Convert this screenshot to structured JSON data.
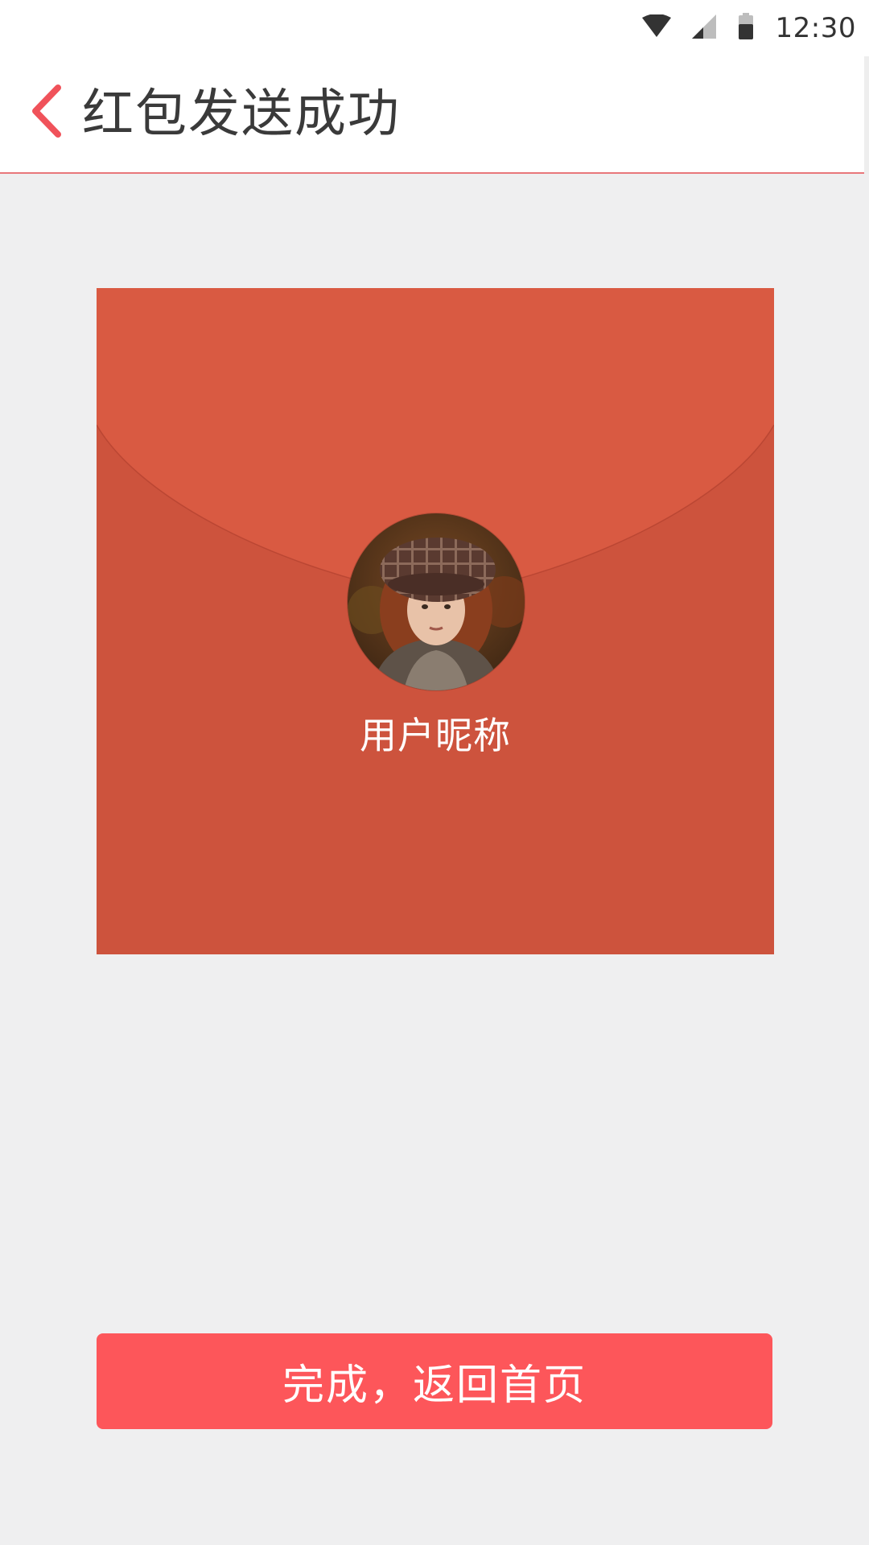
{
  "status_bar": {
    "time": "12:30",
    "icons": [
      "wifi-icon",
      "cell-signal-icon",
      "battery-icon"
    ]
  },
  "header": {
    "back_icon": "chevron-left-icon",
    "title": "红包发送成功"
  },
  "envelope": {
    "avatar_icon": "user-avatar",
    "nickname": "用户昵称"
  },
  "actions": {
    "done_label": "完成，返回首页"
  },
  "colors": {
    "accent": "#fd565a",
    "envelope_body": "#cd533d",
    "envelope_flap": "#d95a42",
    "background": "#efeff0",
    "back_icon": "#f0525a"
  }
}
